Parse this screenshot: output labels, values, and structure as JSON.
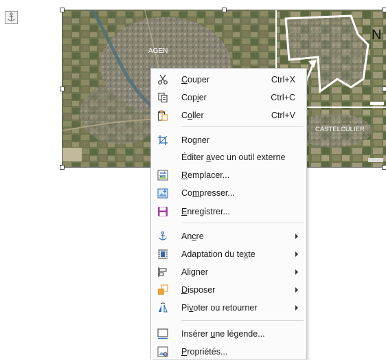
{
  "map": {
    "label_agen": "AGEN",
    "label_castelculier": "CASTELCULIER",
    "label_north": "N"
  },
  "context_menu": {
    "items": [
      {
        "name": "cut",
        "before": "",
        "key": "C",
        "after": "ouper",
        "shortcut": "Ctrl+X",
        "icon": "scissors-icon"
      },
      {
        "name": "copy",
        "before": "Cop",
        "key": "i",
        "after": "er",
        "shortcut": "Ctrl+C",
        "icon": "copy-icon"
      },
      {
        "name": "paste",
        "before": "C",
        "key": "o",
        "after": "ller",
        "shortcut": "Ctrl+V",
        "icon": "paste-icon"
      },
      {
        "name": "crop",
        "before": "Ro",
        "key": "g",
        "after": "ner",
        "shortcut": "",
        "icon": "crop-icon"
      },
      {
        "name": "edit-external",
        "before": "Éditer ",
        "key": "a",
        "after": "vec un outil externe",
        "shortcut": "",
        "icon": ""
      },
      {
        "name": "replace",
        "before": "",
        "key": "R",
        "after": "emplacer...",
        "shortcut": "",
        "icon": "replace-image-icon"
      },
      {
        "name": "compress",
        "before": "Co",
        "key": "m",
        "after": "presser...",
        "shortcut": "",
        "icon": "compress-image-icon"
      },
      {
        "name": "save",
        "before": "",
        "key": "E",
        "after": "nregistrer...",
        "shortcut": "",
        "icon": "save-icon"
      },
      {
        "name": "anchor",
        "before": "An",
        "key": "c",
        "after": "re",
        "shortcut": "",
        "icon": "anchor-icon",
        "submenu": true
      },
      {
        "name": "text-wrap",
        "before": "Adaptation du te",
        "key": "x",
        "after": "te",
        "shortcut": "",
        "icon": "text-wrap-icon",
        "submenu": true
      },
      {
        "name": "align",
        "before": "Ali",
        "key": "g",
        "after": "ner",
        "shortcut": "",
        "icon": "align-icon",
        "submenu": true
      },
      {
        "name": "arrange",
        "before": "",
        "key": "D",
        "after": "isposer",
        "shortcut": "",
        "icon": "arrange-icon",
        "submenu": true
      },
      {
        "name": "rotate-flip",
        "before": "Pi",
        "key": "v",
        "after": "oter ou retourner",
        "shortcut": "",
        "icon": "rotate-flip-icon",
        "submenu": true
      },
      {
        "name": "insert-caption",
        "before": "Insérer ",
        "key": "u",
        "after": "ne légende...",
        "shortcut": "",
        "icon": "caption-icon"
      },
      {
        "name": "properties",
        "before": "",
        "key": "P",
        "after": "ropriétés...",
        "shortcut": "",
        "icon": "properties-icon"
      }
    ]
  }
}
